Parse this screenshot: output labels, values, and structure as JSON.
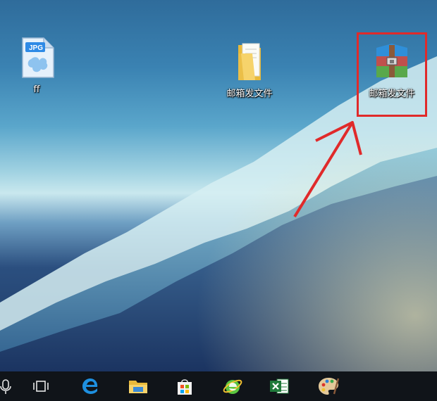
{
  "desktop": {
    "icons": [
      {
        "label": "ff",
        "type_badge": "JPG"
      },
      {
        "label": "邮箱发文件"
      },
      {
        "label": "邮箱发文件"
      }
    ]
  },
  "annotation": {
    "color": "#e02a2a"
  },
  "taskbar": {
    "items": [
      "microphone-icon",
      "task-view-icon",
      "edge-icon",
      "file-explorer-icon",
      "store-icon",
      "ie-browser-icon",
      "excel-icon",
      "paint-icon"
    ]
  }
}
